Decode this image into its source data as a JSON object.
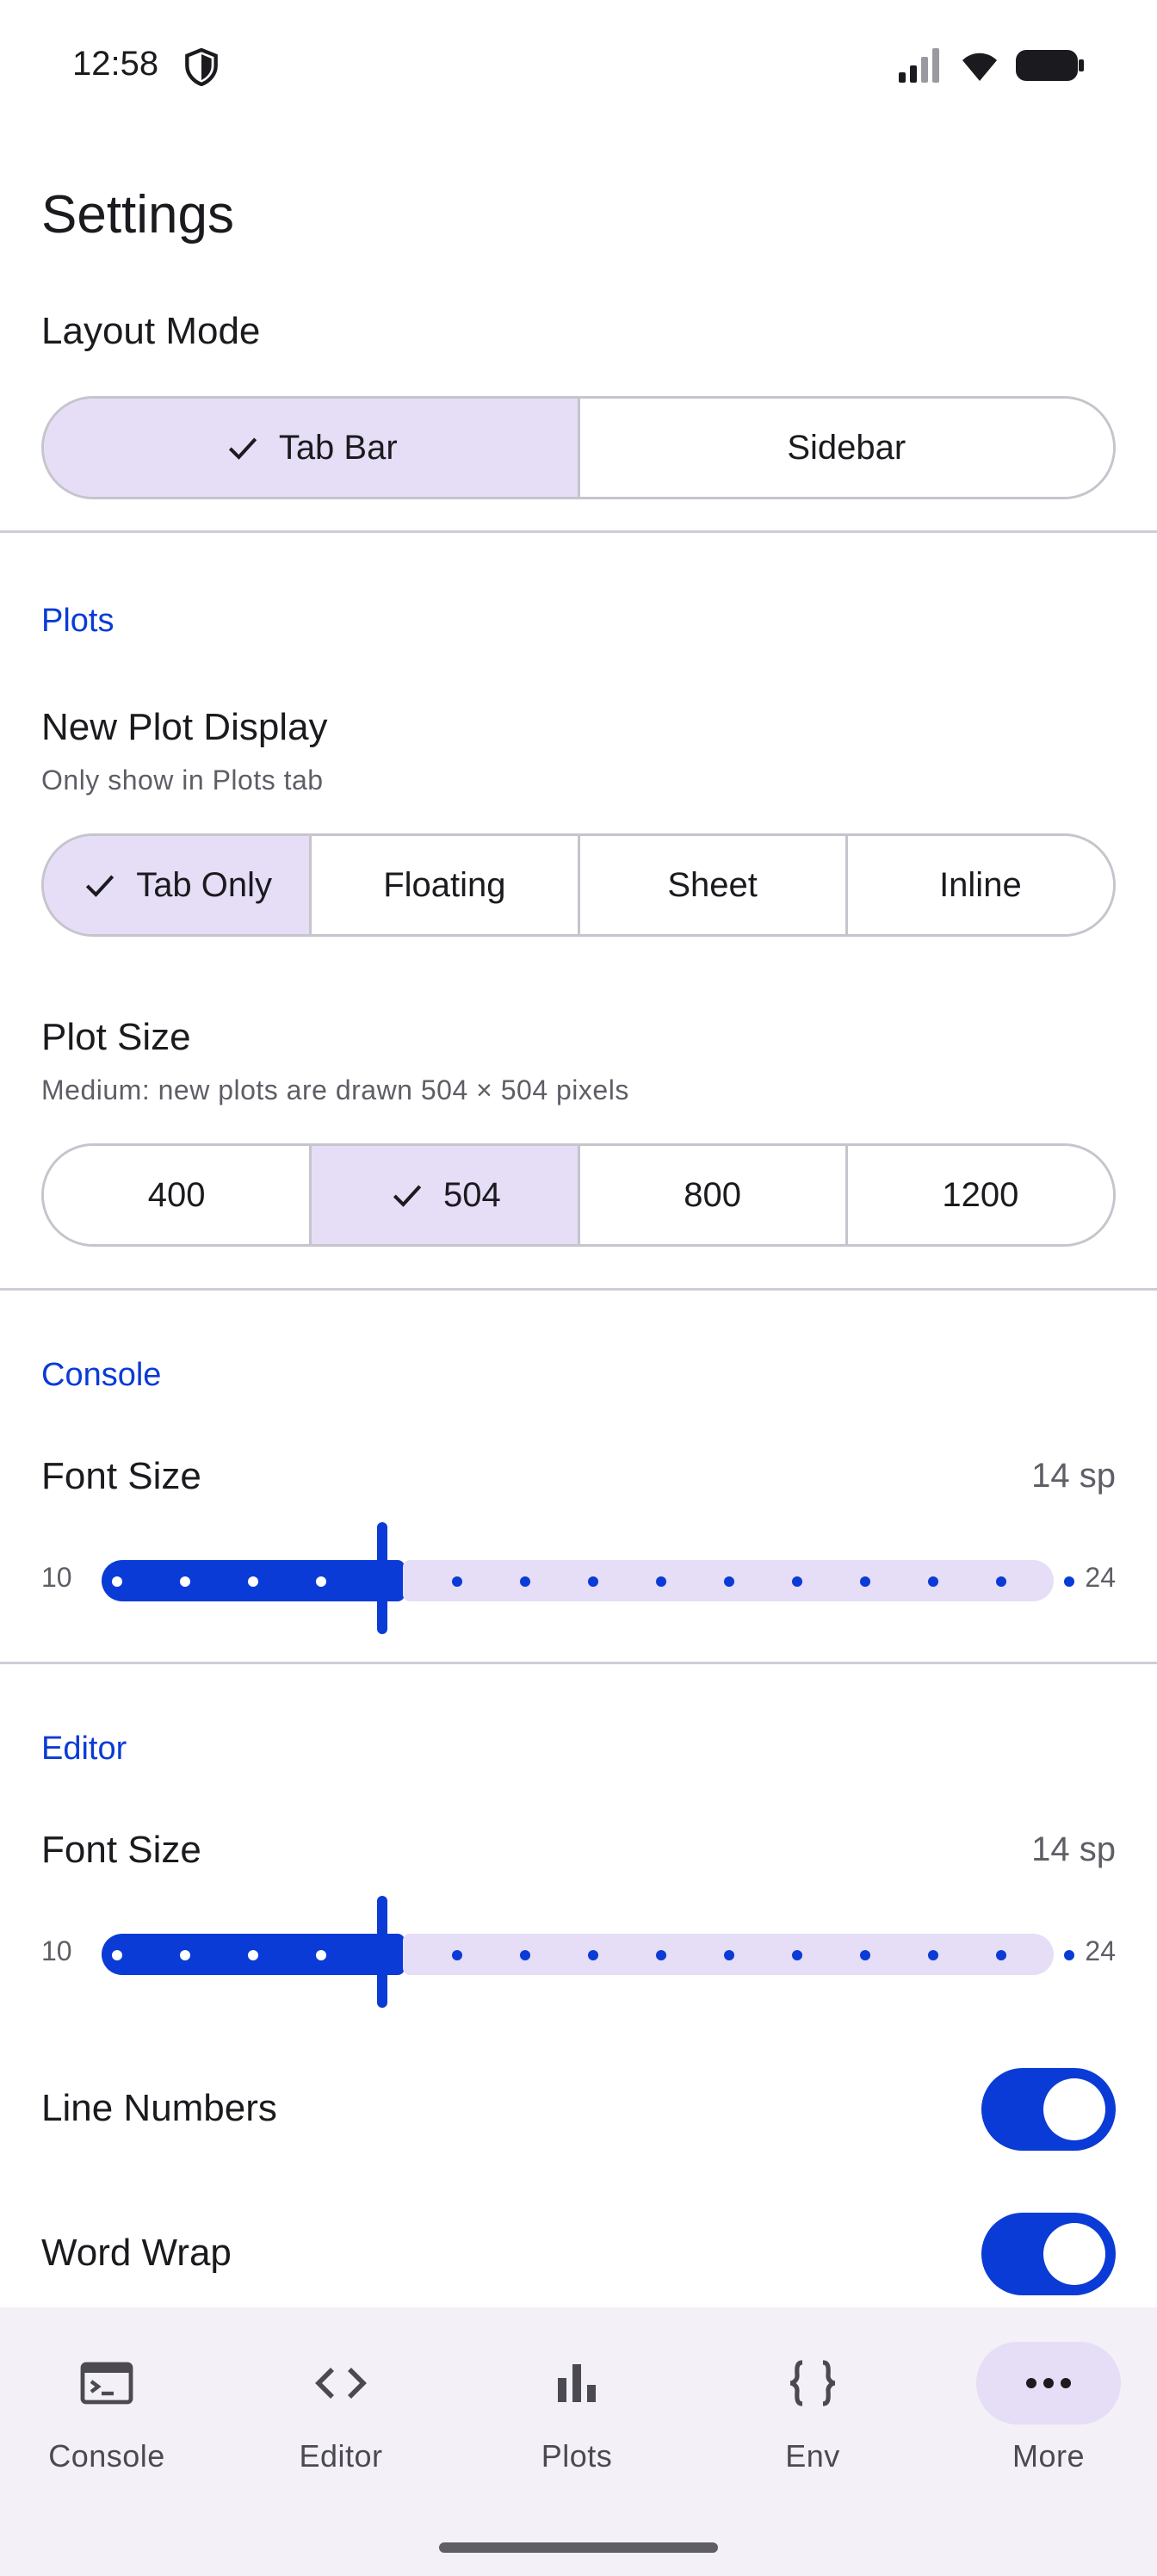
{
  "status_bar": {
    "time": "12:58"
  },
  "page": {
    "title": "Settings"
  },
  "layout_mode": {
    "label": "Layout Mode",
    "options": [
      "Tab Bar",
      "Sidebar"
    ],
    "selected": "Tab Bar"
  },
  "plots": {
    "section": "Plots",
    "new_plot_display": {
      "label": "New Plot Display",
      "description": "Only show in Plots tab",
      "options": [
        "Tab Only",
        "Floating",
        "Sheet",
        "Inline"
      ],
      "selected": "Tab Only"
    },
    "plot_size": {
      "label": "Plot Size",
      "description": "Medium: new plots are drawn 504 × 504 pixels",
      "options": [
        "400",
        "504",
        "800",
        "1200"
      ],
      "selected": "504"
    }
  },
  "console": {
    "section": "Console",
    "font_size": {
      "label": "Font Size",
      "value_text": "14 sp",
      "min": 10,
      "max": 24,
      "value": 14,
      "min_label": "10",
      "max_label": "24"
    }
  },
  "editor": {
    "section": "Editor",
    "font_size": {
      "label": "Font Size",
      "value_text": "14 sp",
      "min": 10,
      "max": 24,
      "value": 14,
      "min_label": "10",
      "max_label": "24"
    },
    "line_numbers": {
      "label": "Line Numbers",
      "on": true
    },
    "word_wrap": {
      "label": "Word Wrap",
      "on": true
    }
  },
  "nav": {
    "items": [
      {
        "label": "Console",
        "icon": "terminal-icon"
      },
      {
        "label": "Editor",
        "icon": "code-icon"
      },
      {
        "label": "Plots",
        "icon": "bar-chart-icon"
      },
      {
        "label": "Env",
        "icon": "braces-icon"
      },
      {
        "label": "More",
        "icon": "more-horiz-icon",
        "active": true
      }
    ]
  },
  "colors": {
    "accent": "#0a3bd6",
    "selected_bg": "#e6ddf6",
    "nav_bg": "#f3f0f8"
  }
}
